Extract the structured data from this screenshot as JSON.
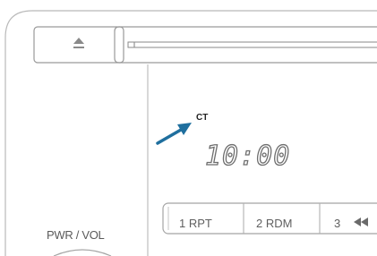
{
  "panel": {
    "power_label": "PWR / VOL",
    "eject_icon": "eject-icon"
  },
  "display": {
    "indicator": "CT",
    "time": "10:00",
    "arrow_color": "#1f6f9e"
  },
  "buttons": [
    {
      "label": "1 RPT"
    },
    {
      "label": "2 RDM"
    },
    {
      "label": "3",
      "icon": "rewind-icon"
    }
  ]
}
